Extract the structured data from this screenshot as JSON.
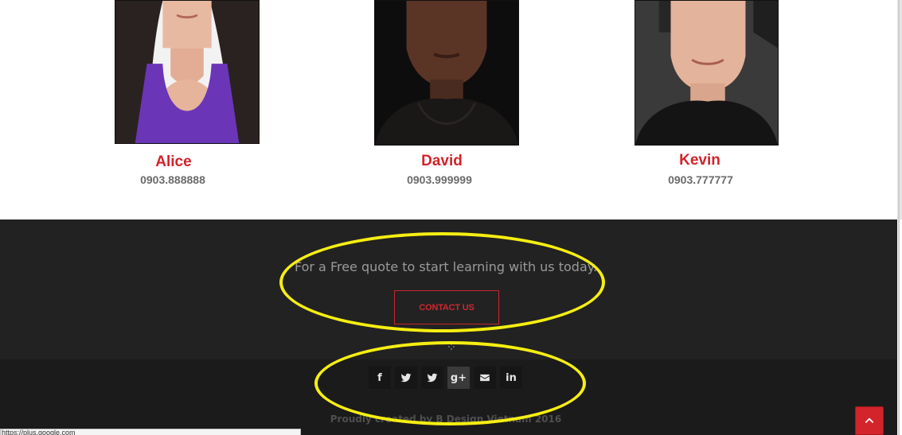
{
  "team": {
    "members": [
      {
        "name": "Alice",
        "phone": "0903.888888"
      },
      {
        "name": "David",
        "phone": "0903.999999"
      },
      {
        "name": "Kevin",
        "phone": "0903.777777"
      }
    ]
  },
  "cta": {
    "quote": "For a Free quote to start learning with us today.",
    "button_label": "CONTACT US"
  },
  "social": [
    {
      "icon": "facebook-icon",
      "glyph": "f"
    },
    {
      "icon": "twitter-icon",
      "glyph": ""
    },
    {
      "icon": "twitter-icon",
      "glyph": ""
    },
    {
      "icon": "google-plus-icon",
      "glyph": "g+"
    },
    {
      "icon": "envelope-icon",
      "glyph": ""
    },
    {
      "icon": "linkedin-icon",
      "glyph": "in"
    }
  ],
  "footer": {
    "credit": "Proudly created by B Design Vietnam 2016"
  },
  "status_bar": {
    "url": "https://plus.google.com"
  },
  "colors": {
    "accent": "#d3222a",
    "footer_bg": "#222222",
    "annotation": "#f6ee12"
  }
}
